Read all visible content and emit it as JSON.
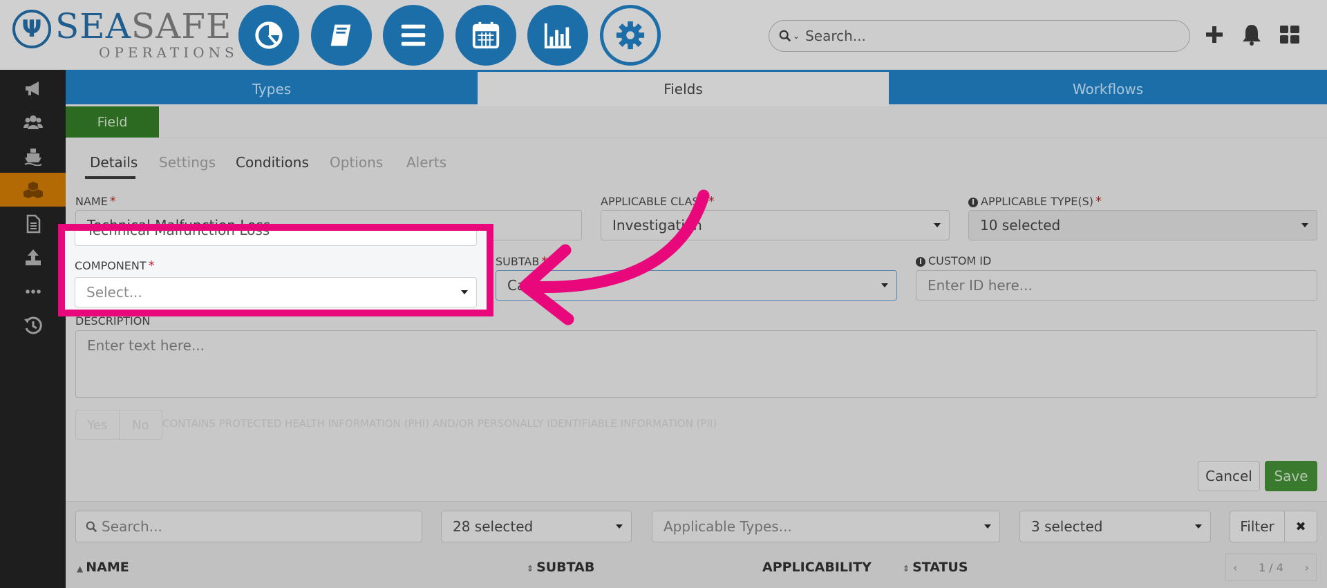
{
  "logo": {
    "word_sea": "SEA",
    "word_safe": "SAFE",
    "subtitle": "OPERATIONS"
  },
  "top_nav": [
    "dashboard-pie",
    "book",
    "list-menu",
    "calendar",
    "bar-chart",
    "settings-gear"
  ],
  "header": {
    "search_placeholder": "Search..."
  },
  "sidebar": [
    "megaphone",
    "users",
    "ship",
    "cubes",
    "document",
    "upload",
    "more",
    "history"
  ],
  "tabs": [
    {
      "label": "Types",
      "active": false
    },
    {
      "label": "Fields",
      "active": true
    },
    {
      "label": "Workflows",
      "active": false
    }
  ],
  "field_button": "Field",
  "subtabs": [
    "Details",
    "Settings",
    "Conditions",
    "Options",
    "Alerts"
  ],
  "form": {
    "name_label": "NAME",
    "name_value": "Technical Malfunction Loss",
    "class_label": "APPLICABLE CLASS",
    "class_value": "Investigation",
    "types_label": "APPLICABLE TYPE(S)",
    "types_value": "10 selected",
    "component_label": "COMPONENT",
    "component_placeholder": "Select...",
    "subtab_label": "SUBTAB",
    "subtab_value": "Cau",
    "custom_id_label": "CUSTOM ID",
    "custom_id_placeholder": "Enter ID here...",
    "description_label": "DESCRIPTION",
    "description_placeholder": "Enter text here...",
    "yes": "Yes",
    "no": "No",
    "phi_text": "CONTAINS PROTECTED HEALTH INFORMATION (PHI) AND/OR PERSONALLY IDENTIFIABLE INFORMATION (PII)",
    "cancel": "Cancel",
    "save": "Save"
  },
  "list_filters": {
    "search_placeholder": "Search...",
    "subtab_filter": "28 selected",
    "types_placeholder": "Applicable Types...",
    "status_filter": "3 selected",
    "filter_button": "Filter",
    "clear_button": "✖"
  },
  "table": {
    "columns": [
      "NAME",
      "SUBTAB",
      "APPLICABILITY",
      "STATUS"
    ],
    "pager": "1 / 4"
  },
  "colors": {
    "primary": "#1c6ea8",
    "success": "#3a7a2f",
    "warning": "#b36a05",
    "highlight": "#e8087b"
  }
}
